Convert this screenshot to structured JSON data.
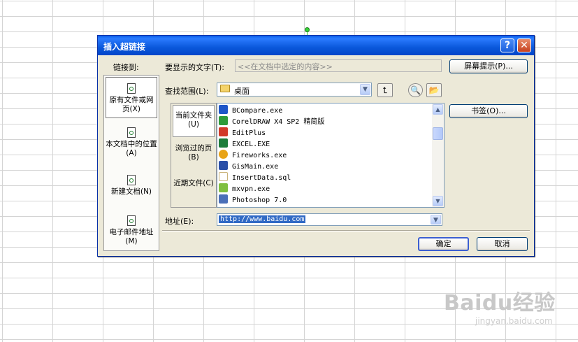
{
  "dialog": {
    "title": "插入超链接",
    "help_glyph": "?",
    "close_glyph": "✕"
  },
  "link_to": {
    "label": "链接到:",
    "items": [
      {
        "label": "原有文件或网页(X)",
        "icon": "existing-file-icon"
      },
      {
        "label": "本文档中的位置(A)",
        "icon": "place-in-document-icon"
      },
      {
        "label": "新建文档(N)",
        "icon": "new-document-icon"
      },
      {
        "label": "电子邮件地址(M)",
        "icon": "email-address-icon"
      }
    ]
  },
  "display_text": {
    "label": "要显示的文字(T):",
    "value": "<<在文档中选定的内容>>"
  },
  "screentip_button": "屏幕提示(P)...",
  "look_in": {
    "label": "查找范围(L):",
    "value": "桌面",
    "folder_icon": "folder-icon"
  },
  "nav": [
    {
      "label": "当前文件夹(U)"
    },
    {
      "label": "浏览过的页(B)"
    },
    {
      "label": "近期文件(C)"
    }
  ],
  "files": [
    {
      "name": "BCompare.exe",
      "color": "#1e56c8"
    },
    {
      "name": "CorelDRAW X4 SP2 精简版",
      "color": "#2e9b3a"
    },
    {
      "name": "EditPlus",
      "color": "#d23a2a"
    },
    {
      "name": "EXCEL.EXE",
      "color": "#1d7d3a"
    },
    {
      "name": "Fireworks.exe",
      "color": "#e8a317"
    },
    {
      "name": "GisMain.exe",
      "color": "#2a4fa8"
    },
    {
      "name": "InsertData.sql",
      "color": "#c9b37a"
    },
    {
      "name": "mxvpn.exe",
      "color": "#7fbf3f"
    },
    {
      "name": "Photoshop 7.0",
      "color": "#4a6fb8"
    }
  ],
  "bookmark_button": "书签(O)...",
  "address": {
    "label": "地址(E):",
    "value": "http://www.baidu.com"
  },
  "ok_button": "确定",
  "cancel_button": "取消",
  "watermark": {
    "main": "Baidu经验",
    "sub": "jingyan.baidu.com"
  }
}
